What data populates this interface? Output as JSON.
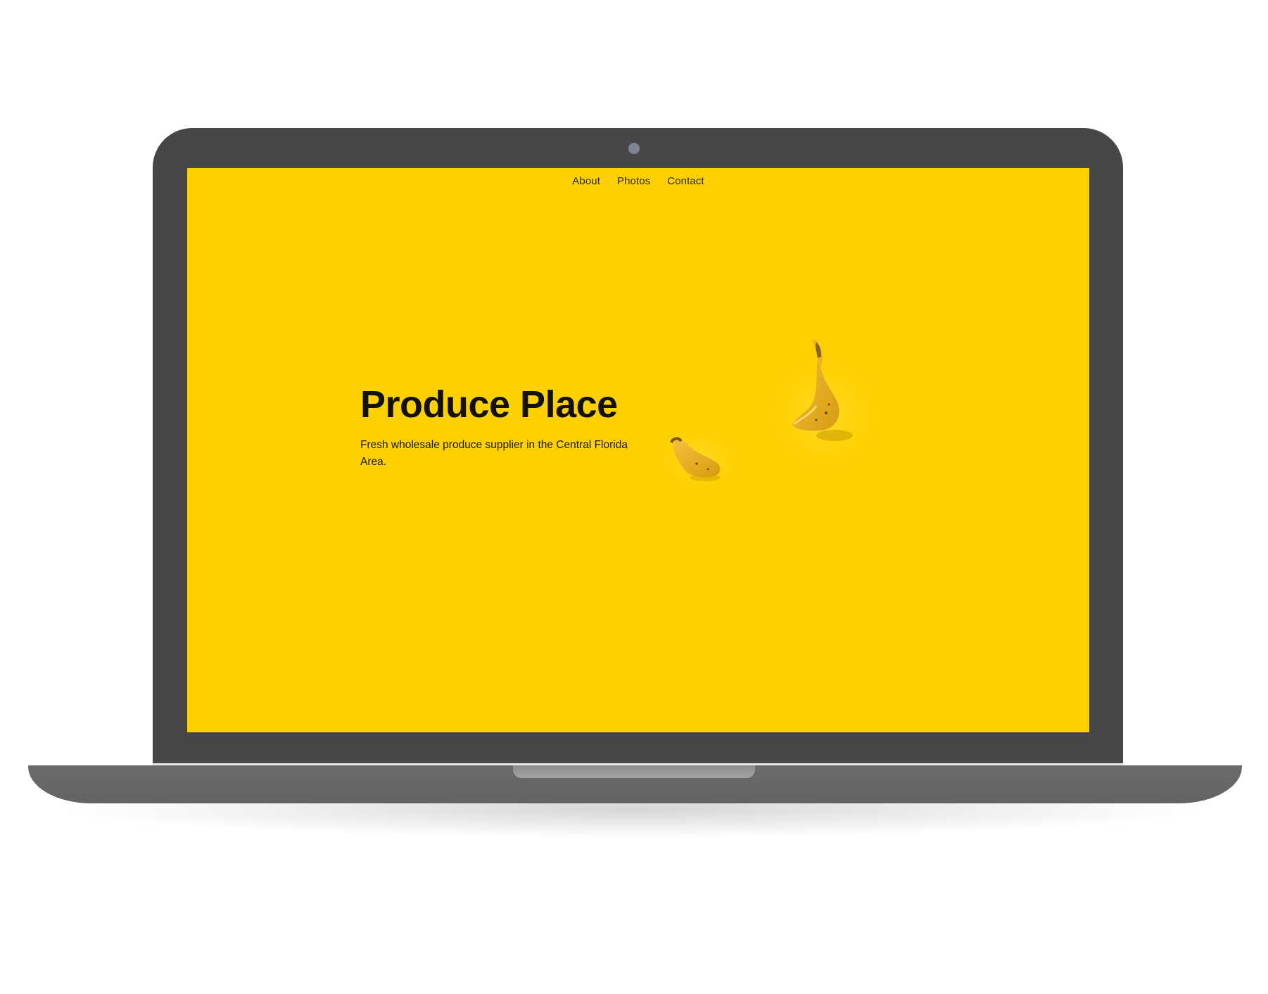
{
  "site": {
    "nav": {
      "items": [
        {
          "label": "About"
        },
        {
          "label": "Photos"
        },
        {
          "label": "Contact"
        }
      ]
    },
    "hero": {
      "title": "Produce Place",
      "subtitle": "Fresh wholesale produce supplier in the Central Florida Area."
    },
    "image": {
      "subject": "banana-pieces-photo"
    }
  },
  "colors": {
    "screen_background": "#ffd000",
    "laptop_bezel": "#474747",
    "laptop_base": "#676767",
    "camera": "#7d8494",
    "text": "#111111"
  }
}
